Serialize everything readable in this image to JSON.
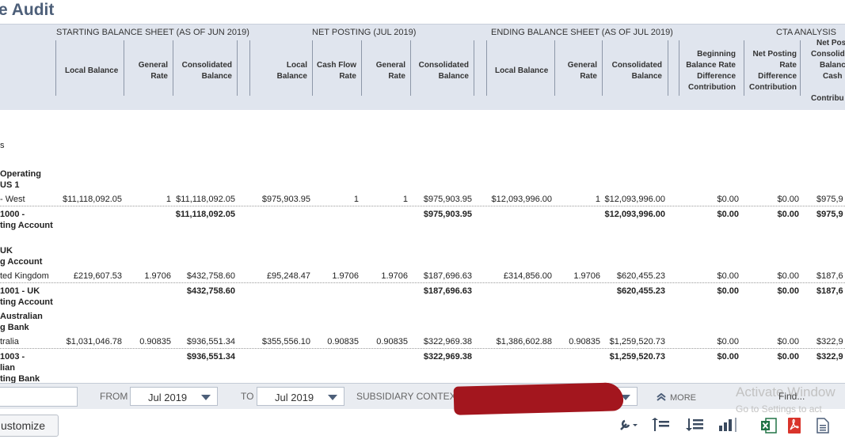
{
  "page_title": "e Audit",
  "groups": {
    "starting": "STARTING BALANCE SHEET (AS OF JUN 2019)",
    "net": "NET POSTING (JUL 2019)",
    "ending": "ENDING BALANCE SHEET (AS OF JUL 2019)",
    "cta": "CTA ANALYSIS"
  },
  "columns": {
    "s_local": "Local Balance",
    "s_rate": [
      "General",
      "Rate"
    ],
    "s_cons": [
      "Consolidated",
      "Balance"
    ],
    "n_local": [
      "Local",
      "Balance"
    ],
    "n_cf": [
      "Cash Flow",
      "Rate"
    ],
    "n_rate": [
      "General",
      "Rate"
    ],
    "n_cons": [
      "Consolidated",
      "Balance"
    ],
    "e_local": "Local Balance",
    "e_rate": [
      "General",
      "Rate"
    ],
    "e_cons": [
      "Consolidated",
      "Balance"
    ],
    "c_begin": [
      "Beginning",
      "Balance Rate",
      "Difference",
      "Contribution"
    ],
    "c_net": [
      "Net Posting",
      "Rate",
      "Difference",
      "Contribution"
    ],
    "c_cut": [
      "Net Pos",
      "Consolid",
      "Balanc",
      "Cash",
      "Contribu"
    ]
  },
  "section_label": "s",
  "blocks": [
    {
      "heading": [
        "Operating",
        "US 1"
      ],
      "row": {
        "label": "- West",
        "s_local": "$11,118,092.05",
        "s_rate": "1",
        "s_cons": "$11,118,092.05",
        "n_local": "$975,903.95",
        "n_cf": "1",
        "n_rate": "1",
        "n_cons": "$975,903.95",
        "e_local": "$12,093,996.00",
        "e_rate": "1",
        "e_cons": "$12,093,996.00",
        "c_begin": "$0.00",
        "c_net": "$0.00",
        "c_cut": "$975,9"
      },
      "total": {
        "label": [
          "1000 -",
          "ting Account"
        ],
        "s_cons": "$11,118,092.05",
        "n_cons": "$975,903.95",
        "e_cons": "$12,093,996.00",
        "c_begin": "$0.00",
        "c_net": "$0.00",
        "c_cut": "$975,9"
      }
    },
    {
      "heading": [
        "UK",
        "g Account"
      ],
      "row": {
        "label": "ted Kingdom",
        "s_local": "£219,607.53",
        "s_rate": "1.9706",
        "s_cons": "$432,758.60",
        "n_local": "£95,248.47",
        "n_cf": "1.9706",
        "n_rate": "1.9706",
        "n_cons": "$187,696.63",
        "e_local": "£314,856.00",
        "e_rate": "1.9706",
        "e_cons": "$620,455.23",
        "c_begin": "$0.00",
        "c_net": "$0.00",
        "c_cut": "$187,6"
      },
      "total": {
        "label": [
          "1001 - UK",
          "ting Account"
        ],
        "s_cons": "$432,758.60",
        "n_cons": "$187,696.63",
        "e_cons": "$620,455.23",
        "c_begin": "$0.00",
        "c_net": "$0.00",
        "c_cut": "$187,6"
      }
    },
    {
      "heading": [
        "Australian",
        "g Bank"
      ],
      "row": {
        "label": "tralia",
        "s_local": "$1,031,046.78",
        "s_rate": "0.90835",
        "s_cons": "$936,551.34",
        "n_local": "$355,556.10",
        "n_cf": "0.90835",
        "n_rate": "0.90835",
        "n_cons": "$322,969.38",
        "e_local": "$1,386,602.88",
        "e_rate": "0.90835",
        "e_cons": "$1,259,520.73",
        "c_begin": "$0.00",
        "c_net": "$0.00",
        "c_cut": "$322,9"
      },
      "total": {
        "label": [
          "1003 -",
          "lian",
          "ting Bank"
        ],
        "s_cons": "$936,551.34",
        "n_cons": "$322,969.38",
        "e_cons": "$1,259,520.73",
        "c_begin": "$0.00",
        "c_net": "$0.00",
        "c_cut": "$322,9"
      }
    }
  ],
  "footer": {
    "from_label": "FROM",
    "from_value": "Jul 2019",
    "to_label": "TO",
    "to_value": "Jul 2019",
    "subsidiary_label": "SUBSIDIARY CONTEXT",
    "more_label": "MORE",
    "find_label": "Find...",
    "activate_line1": "Activate Window",
    "activate_line2": "Go to Settings to act"
  },
  "customize_label": "ustomize",
  "accent_color": "#4d5f79",
  "header_bg": "#e0e5ee"
}
